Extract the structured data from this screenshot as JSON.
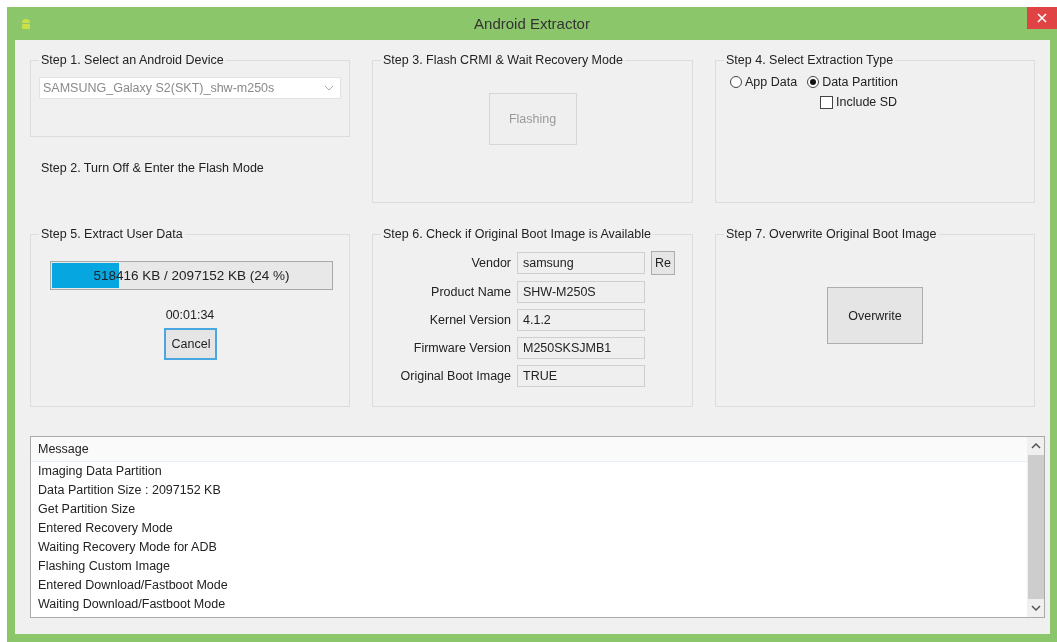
{
  "window": {
    "title": "Android Extractor"
  },
  "step1": {
    "title": "Step 1. Select an Android Device",
    "device": {
      "value": "SAMSUNG_Galaxy S2(SKT)_shw-m250s",
      "disabled": true
    }
  },
  "step2": {
    "label": "Step 2. Turn Off & Enter the Flash Mode"
  },
  "step3": {
    "title": "Step 3. Flash CRMI & Wait Recovery Mode",
    "button": {
      "label": "Flashing",
      "disabled": true
    }
  },
  "step4": {
    "title": "Step 4. Select Extraction Type",
    "options": [
      {
        "kind": "radio",
        "label": "App Data",
        "selected": false
      },
      {
        "kind": "radio",
        "label": "Data Partition",
        "selected": true
      },
      {
        "kind": "checkbox",
        "label": "Include SD",
        "checked": false
      }
    ]
  },
  "step5": {
    "title": "Step 5. Extract User Data",
    "progress": {
      "level": 0.24,
      "text": "518416 KB / 2097152 KB (24 %)"
    },
    "elapsed": "00:01:34",
    "button": {
      "label": "Cancel",
      "focused": true
    }
  },
  "step6": {
    "title": "Step 6. Check if Original Boot Image is Available",
    "fields": [
      {
        "label": "Vendor",
        "value": "samsung"
      },
      {
        "label": "Product Name",
        "value": "SHW-M250S"
      },
      {
        "label": "Kernel Version",
        "value": "4.1.2"
      },
      {
        "label": "Firmware Version",
        "value": "M250SKSJMB1"
      },
      {
        "label": "Original Boot Image",
        "value": "TRUE"
      }
    ],
    "refresh_button": "Re"
  },
  "step7": {
    "title": "Step 7. Overwrite Original Boot Image",
    "button": "Overwrite"
  },
  "messages": {
    "column": "Message",
    "rows": [
      "Imaging Data Partition",
      "Data Partition Size : 2097152 KB",
      "Get Partition Size",
      "Entered Recovery Mode",
      "Waiting Recovery Mode for ADB",
      "Flashing Custom Image",
      "Entered Download/Fastboot Mode",
      "Waiting Download/Fastboot Mode"
    ]
  }
}
